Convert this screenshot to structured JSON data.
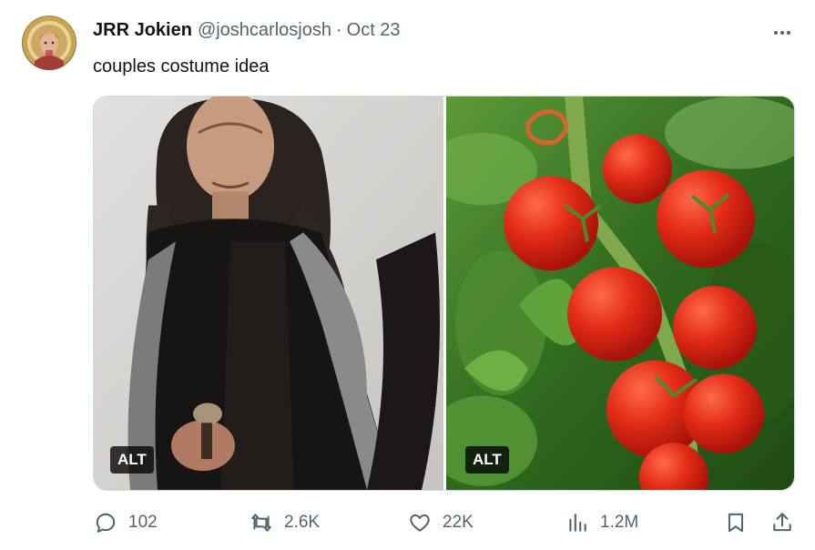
{
  "tweet": {
    "display_name": "JRR Jokien",
    "handle": "@joshcarlosjosh",
    "separator": "·",
    "date": "Oct 23",
    "text": "couples costume idea"
  },
  "media": [
    {
      "alt_badge": "ALT",
      "subject": "man-in-dark-fur-robe-photo"
    },
    {
      "alt_badge": "ALT",
      "subject": "tomatoes-on-vine-photo"
    }
  ],
  "actions": {
    "reply_count": "102",
    "retweet_count": "2.6K",
    "like_count": "22K",
    "views_count": "1.2M"
  },
  "icons": {
    "more": "more-horizontal-icon",
    "reply": "reply-icon",
    "retweet": "retweet-icon",
    "like": "heart-icon",
    "views": "bar-chart-icon",
    "bookmark": "bookmark-icon",
    "share": "share-icon"
  },
  "colors": {
    "text_primary": "#0f1419",
    "text_secondary": "#536471",
    "border": "#cfd9de",
    "alt_badge_bg": "#000000"
  }
}
